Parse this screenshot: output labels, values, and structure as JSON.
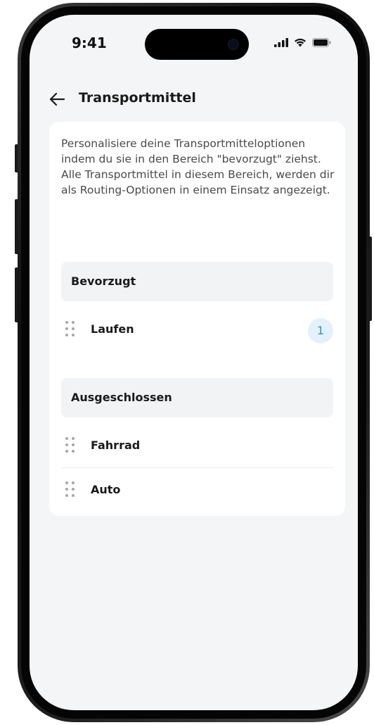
{
  "status_bar": {
    "time": "9:41",
    "icons": [
      "cellular-signal-icon",
      "wifi-icon",
      "battery-icon"
    ]
  },
  "header": {
    "title": "Transportmittel",
    "back_icon": "arrow-left-icon"
  },
  "card": {
    "description": "Personalisiere deine Transportmitteloptionen indem du sie in den Bereich \"bevorzugt\" ziehst. Alle Transportmittel in diesem Bereich, werden dir als Routing-Optionen in einem Einsatz angezeigt.",
    "sections": [
      {
        "title": "Bevorzugt",
        "items": [
          {
            "label": "Laufen",
            "badge": "1"
          }
        ]
      },
      {
        "title": "Ausgeschlossen",
        "items": [
          {
            "label": "Fahrrad"
          },
          {
            "label": "Auto"
          }
        ]
      }
    ]
  },
  "colors": {
    "screen_background": "#f4f5f6",
    "card_background": "#ffffff",
    "section_header_background": "#f2f3f5",
    "badge_background": "#e3f1fb",
    "badge_text": "#3a8fcc",
    "primary_text": "#1a1a1a",
    "secondary_text": "#4a4a4a"
  }
}
